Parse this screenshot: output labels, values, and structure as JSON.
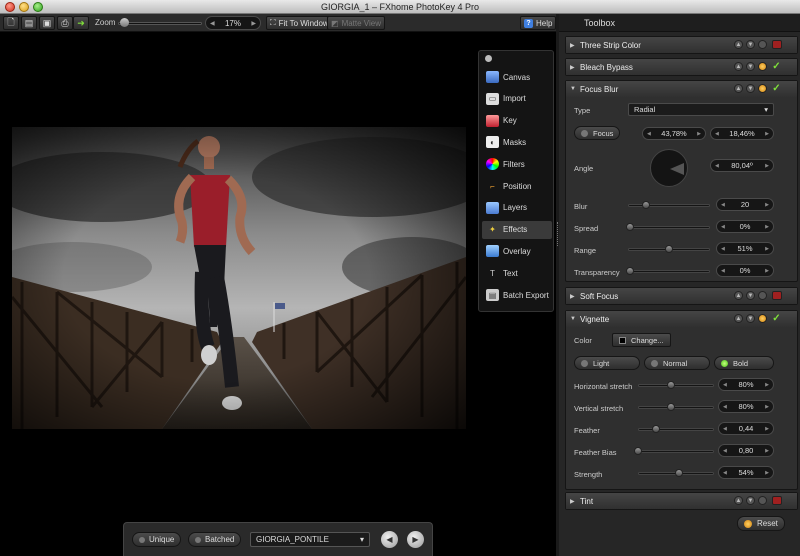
{
  "window": {
    "title": "GIORGIA_1 – FXhome PhotoKey 4 Pro"
  },
  "toolbar": {
    "zoom_label": "Zoom",
    "zoom_value": "17%",
    "zoom_fraction": 0.02,
    "fit_to_window": "Fit To Window",
    "matte_view": "Matte View",
    "help": "Help"
  },
  "tools": {
    "items": [
      {
        "label": "Canvas",
        "icon": "canvas-icon"
      },
      {
        "label": "Import",
        "icon": "import-icon"
      },
      {
        "label": "Key",
        "icon": "key-icon"
      },
      {
        "label": "Masks",
        "icon": "masks-icon"
      },
      {
        "label": "Filters",
        "icon": "filters-icon"
      },
      {
        "label": "Position",
        "icon": "position-icon"
      },
      {
        "label": "Layers",
        "icon": "layers-icon"
      },
      {
        "label": "Effects",
        "icon": "effects-icon"
      },
      {
        "label": "Overlay",
        "icon": "overlay-icon"
      },
      {
        "label": "Text",
        "icon": "text-icon"
      },
      {
        "label": "Batch Export",
        "icon": "batch-export-icon"
      }
    ],
    "active": "Effects"
  },
  "bottombar": {
    "unique": "Unique",
    "batched": "Batched",
    "file_select": "GIORGIA_PONTILE"
  },
  "toolbox": {
    "title": "Toolbox",
    "three_strip": "Three Strip Color",
    "bleach_bypass": "Bleach Bypass",
    "focus_blur": {
      "title": "Focus Blur",
      "type_label": "Type",
      "type_value": "Radial",
      "focus_button": "Focus",
      "focus_x": "43,78%",
      "focus_y": "18,46%",
      "angle_label": "Angle",
      "angle_value": "80,04º",
      "blur_label": "Blur",
      "blur_value": "20",
      "spread_label": "Spread",
      "spread_value": "0%",
      "range_label": "Range",
      "range_value": "51%",
      "transparency_label": "Transparency",
      "transparency_value": "0%"
    },
    "soft_focus": "Soft Focus",
    "vignette": {
      "title": "Vignette",
      "color_label": "Color",
      "change_button": "Change...",
      "light": "Light",
      "normal": "Normal",
      "bold": "Bold",
      "h_stretch_label": "Horizontal stretch",
      "h_stretch_value": "80%",
      "v_stretch_label": "Vertical stretch",
      "v_stretch_value": "80%",
      "feather_label": "Feather",
      "feather_value": "0,44",
      "feather_bias_label": "Feather Bias",
      "feather_bias_value": "0,80",
      "strength_label": "Strength",
      "strength_value": "54%"
    },
    "tint": "Tint",
    "reset": "Reset"
  },
  "colors": {
    "accent_green": "#7fe03a",
    "accent_orange": "#d08010",
    "panel": "#262626"
  }
}
